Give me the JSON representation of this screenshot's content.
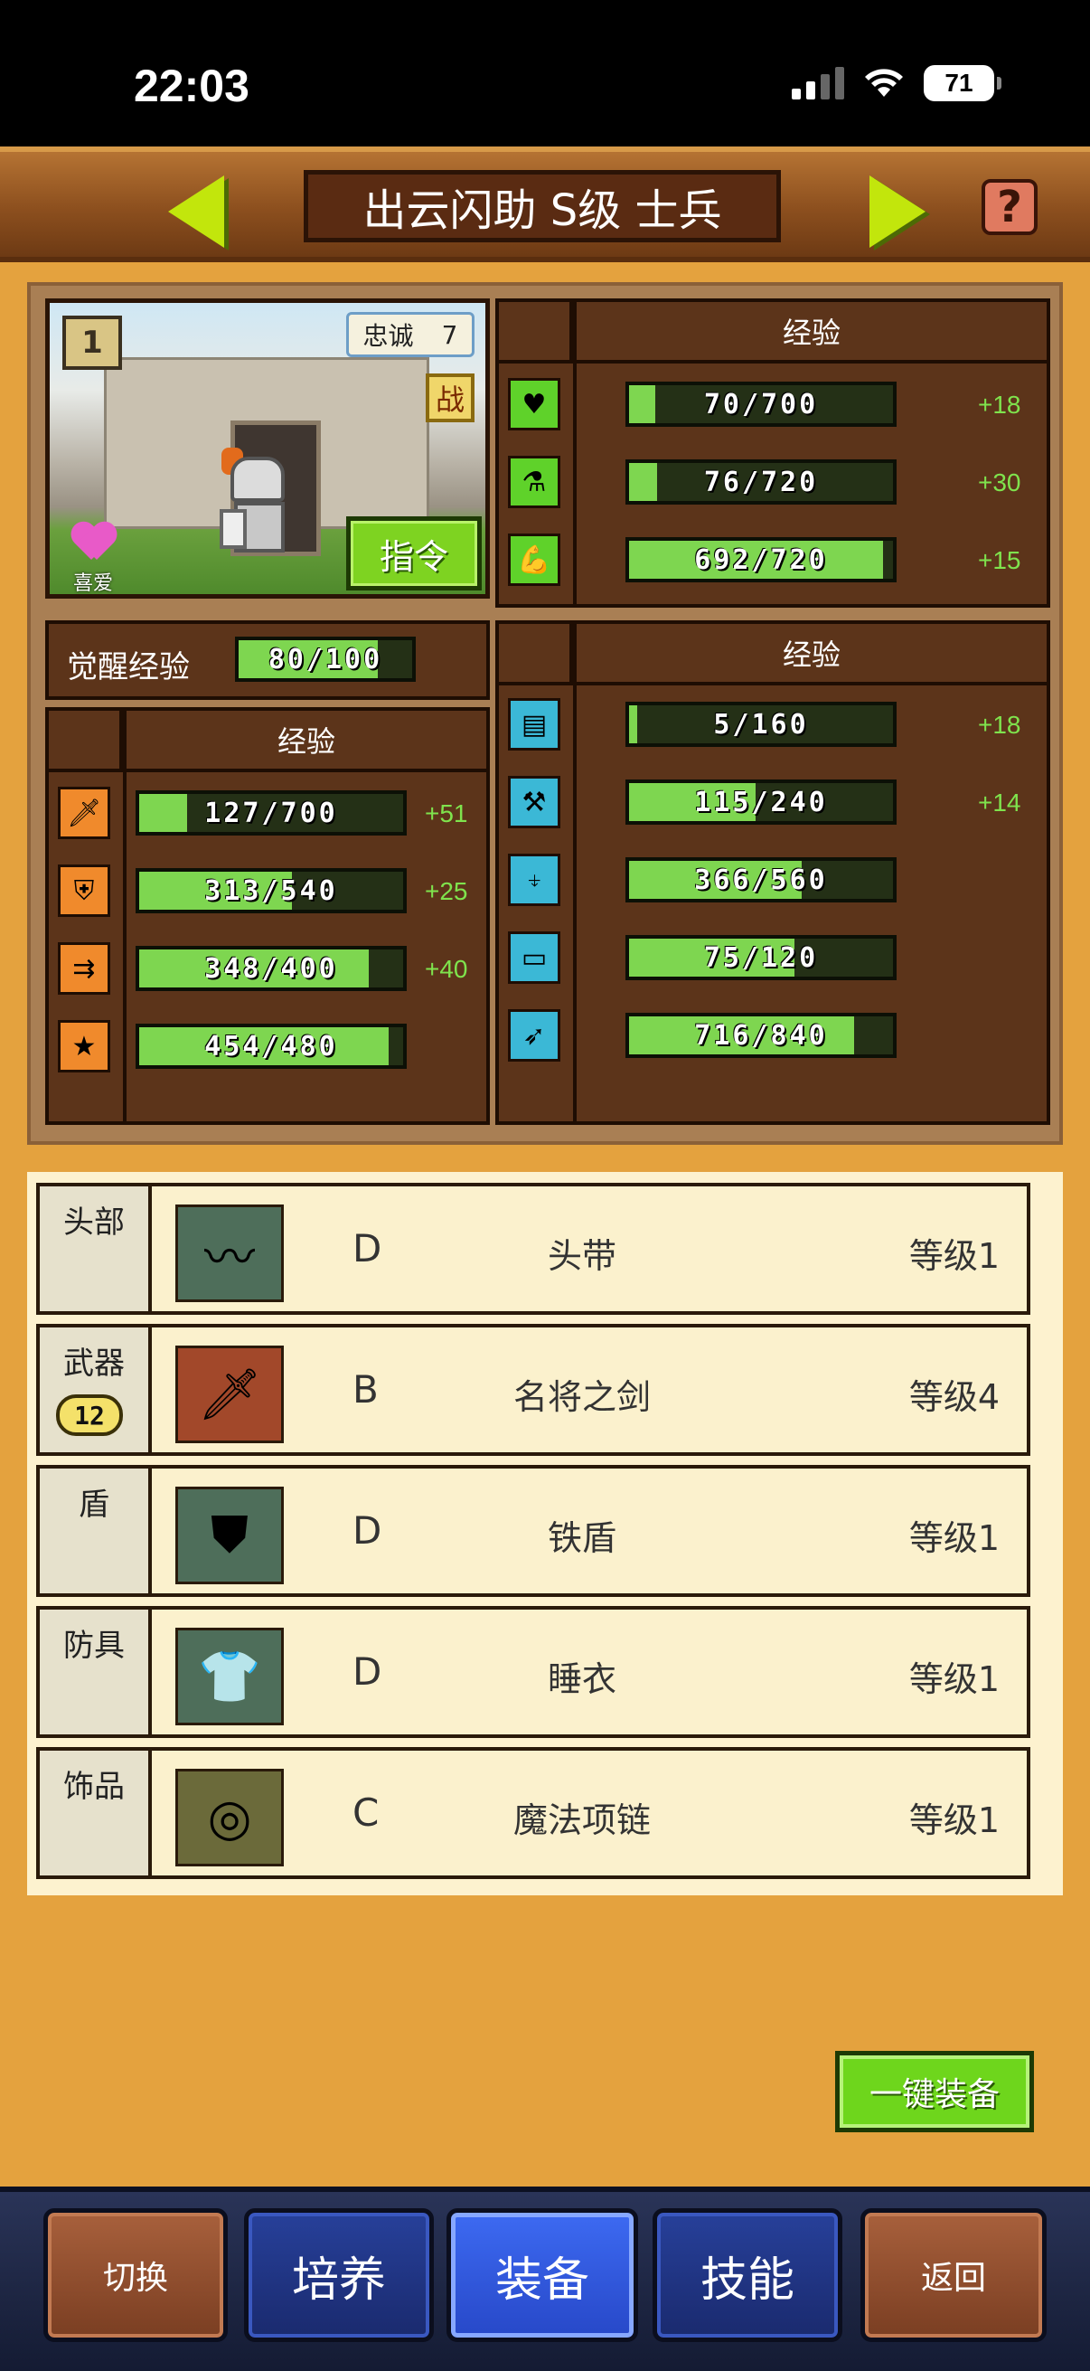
{
  "status_bar": {
    "time": "22:03",
    "battery": "71"
  },
  "header": {
    "title": "出云闪助 S级 士兵"
  },
  "portrait": {
    "rank": "1",
    "loyalty_label": "忠诚",
    "loyalty_value": "7",
    "battle_badge": "战",
    "favorite_label": "喜爱",
    "command_button": "指令"
  },
  "stats_main": {
    "header": "经验",
    "rows": [
      {
        "icon": "heart-icon",
        "current": "70",
        "max": "700",
        "fill": 0.1,
        "bonus": "+18"
      },
      {
        "icon": "potion-icon",
        "current": "76",
        "max": "720",
        "fill": 0.106,
        "bonus": "+30"
      },
      {
        "icon": "muscle-icon",
        "current": "692",
        "max": "720",
        "fill": 0.961,
        "bonus": "+15"
      }
    ]
  },
  "awakening": {
    "label": "觉醒经验",
    "current": "80",
    "max": "100",
    "fill": 0.8
  },
  "stats_combat": {
    "header": "经验",
    "rows": [
      {
        "icon": "sword-icon",
        "current": "127",
        "max": "700",
        "fill": 0.181,
        "bonus": "+51"
      },
      {
        "icon": "shield-icon",
        "current": "313",
        "max": "540",
        "fill": 0.58,
        "bonus": "+25"
      },
      {
        "icon": "speed-icon",
        "current": "348",
        "max": "400",
        "fill": 0.87,
        "bonus": "+40"
      },
      {
        "icon": "star-icon",
        "current": "454",
        "max": "480",
        "fill": 0.946,
        "bonus": ""
      }
    ]
  },
  "stats_work": {
    "header": "经验",
    "rows": [
      {
        "icon": "book-icon",
        "current": "5",
        "max": "160",
        "fill": 0.03,
        "bonus": "+18"
      },
      {
        "icon": "pickaxe-icon",
        "current": "115",
        "max": "240",
        "fill": 0.48,
        "bonus": "+14"
      },
      {
        "icon": "shovel-icon",
        "current": "366",
        "max": "560",
        "fill": 0.654,
        "bonus": ""
      },
      {
        "icon": "anvil-icon",
        "current": "75",
        "max": "120",
        "fill": 0.625,
        "bonus": ""
      },
      {
        "icon": "fish-icon",
        "current": "716",
        "max": "840",
        "fill": 0.852,
        "bonus": ""
      }
    ]
  },
  "equipment": [
    {
      "slot": "头部",
      "grade": "D",
      "name": "头带",
      "level": "等级1",
      "icon": "headband-icon",
      "icon_bg": "#4e6e5a"
    },
    {
      "slot": "武器",
      "slot_badge": "12",
      "grade": "B",
      "name": "名将之剑",
      "level": "等级4",
      "icon": "sword-icon",
      "icon_bg": "#a2482a"
    },
    {
      "slot": "盾",
      "grade": "D",
      "name": "铁盾",
      "level": "等级1",
      "icon": "iron-shield-icon",
      "icon_bg": "#4e6e5a"
    },
    {
      "slot": "防具",
      "grade": "D",
      "name": "睡衣",
      "level": "等级1",
      "icon": "pajamas-icon",
      "icon_bg": "#4e6e5a"
    },
    {
      "slot": "饰品",
      "grade": "C",
      "name": "魔法项链",
      "level": "等级1",
      "icon": "necklace-icon",
      "icon_bg": "#6b6a3a"
    }
  ],
  "auto_equip_button": "一键装备",
  "bottom_nav": [
    {
      "label": "切换"
    },
    {
      "label": "培养"
    },
    {
      "label": "装备"
    },
    {
      "label": "技能"
    },
    {
      "label": "返回"
    }
  ]
}
